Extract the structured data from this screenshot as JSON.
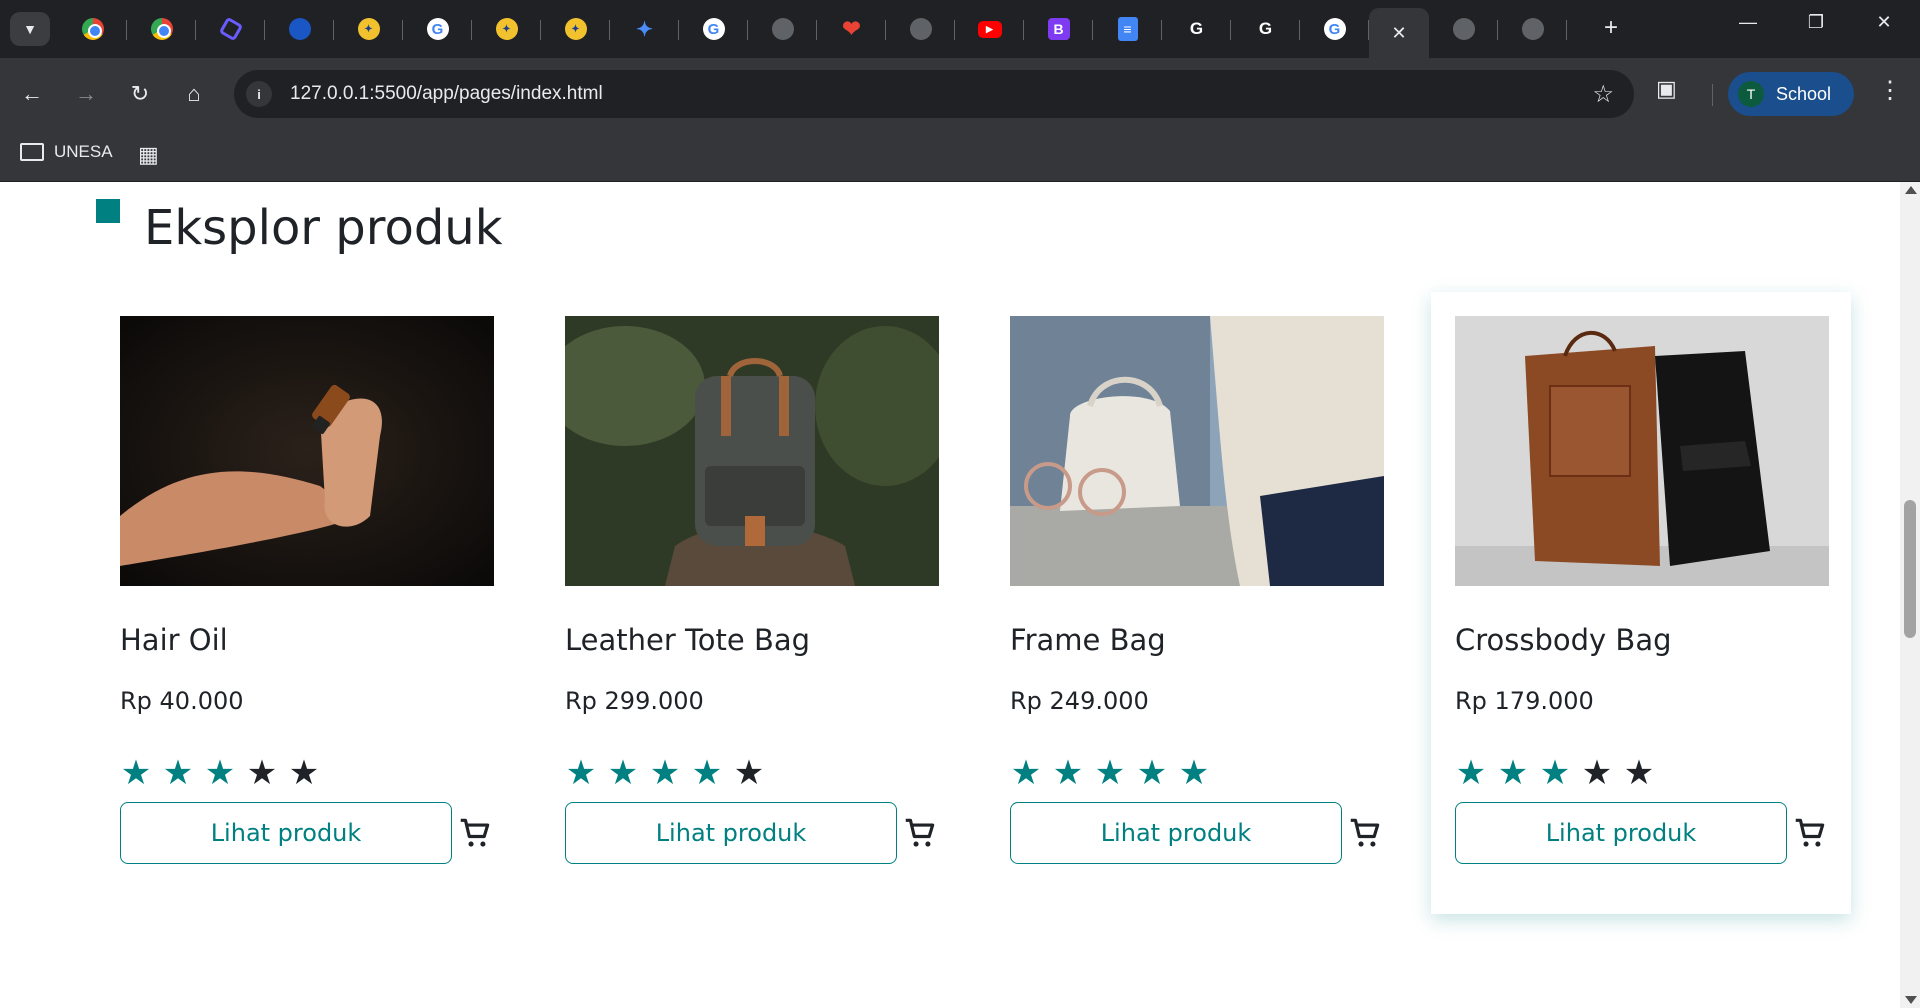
{
  "browser": {
    "tabs": [
      {
        "icon": "chrome-icon"
      },
      {
        "icon": "chrome-icon"
      },
      {
        "icon": "hexagon-app-icon"
      },
      {
        "icon": "blue-app-icon"
      },
      {
        "icon": "unesa-icon"
      },
      {
        "icon": "google-icon"
      },
      {
        "icon": "unesa-icon"
      },
      {
        "icon": "unesa-icon"
      },
      {
        "icon": "gemini-icon"
      },
      {
        "icon": "google-icon"
      },
      {
        "icon": "globe-icon"
      },
      {
        "icon": "heart-icon"
      },
      {
        "icon": "globe-icon"
      },
      {
        "icon": "youtube-icon"
      },
      {
        "icon": "bootstrap-icon"
      },
      {
        "icon": "docs-icon"
      },
      {
        "icon": "google-dark-icon"
      },
      {
        "icon": "google-dark-icon"
      },
      {
        "icon": "google-icon"
      },
      {
        "icon": "close-icon",
        "active": true
      },
      {
        "icon": "globe-icon"
      },
      {
        "icon": "globe-icon"
      }
    ],
    "url": "127.0.0.1:5500/app/pages/index.html",
    "profile": {
      "initial": "T",
      "label": "School"
    },
    "bookmarks": {
      "folder_label": "UNESA"
    }
  },
  "page": {
    "section_title": "Eksplor produk",
    "accent_color": "#008080",
    "button_label": "Lihat produk",
    "products": [
      {
        "name": "Hair Oil",
        "price": "Rp 40.000",
        "rating": 3,
        "max_rating": 5,
        "image": "hair-oil-photo"
      },
      {
        "name": "Leather Tote Bag",
        "price": "Rp 299.000",
        "rating": 4,
        "max_rating": 5,
        "image": "backpack-photo"
      },
      {
        "name": "Frame Bag",
        "price": "Rp 249.000",
        "rating": 5,
        "max_rating": 5,
        "image": "white-frame-bag-photo"
      },
      {
        "name": "Crossbody Bag",
        "price": "Rp 179.000",
        "rating": 3,
        "max_rating": 5,
        "image": "crossbody-bags-photo"
      }
    ]
  }
}
